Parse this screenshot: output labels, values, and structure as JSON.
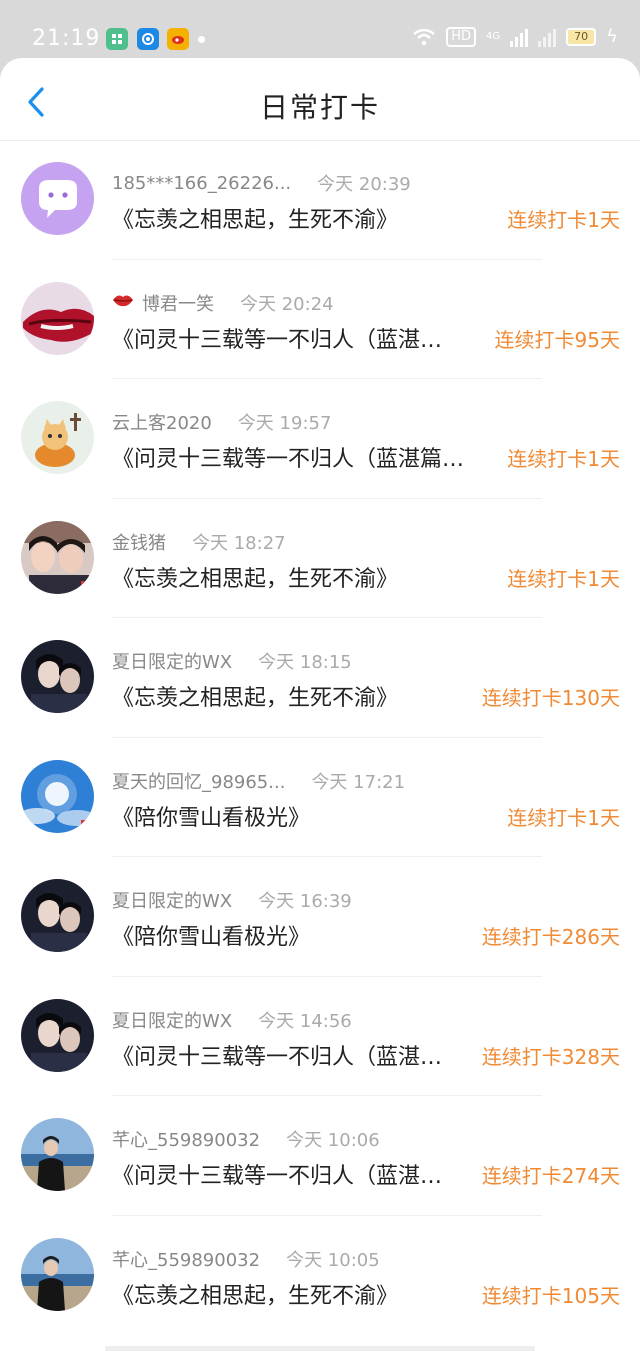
{
  "status_bar": {
    "time": "21:19",
    "hd_label": "HD",
    "network_label": "4G",
    "battery": "70"
  },
  "header": {
    "title": "日常打卡",
    "back_icon": "chevron-left-icon"
  },
  "colors": {
    "accent_back": "#1a8ff0",
    "streak": "#f08a35",
    "name": "#888888",
    "time": "#aaaaaa"
  },
  "items": [
    {
      "name": "185***166_26226...",
      "time": "今天 20:39",
      "title": "《忘羡之相思起，生死不渝》",
      "streak": "连续打卡1天",
      "avatar": "chat-bubble-avatar",
      "badge": ""
    },
    {
      "name": "博君一笑",
      "time": "今天 20:24",
      "title": "《问灵十三载等一不归人（蓝湛…",
      "streak": "连续打卡95天",
      "avatar": "lips-avatar",
      "badge": "lips-icon"
    },
    {
      "name": "云上客2020",
      "time": "今天 19:57",
      "title": "《问灵十三载等一不归人（蓝湛篇…",
      "streak": "连续打卡1天",
      "avatar": "cat-pumpkin-avatar",
      "badge": ""
    },
    {
      "name": "金钱猪",
      "time": "今天 18:27",
      "title": "《忘羡之相思起，生死不渝》",
      "streak": "连续打卡1天",
      "avatar": "two-people-avatar",
      "badge": ""
    },
    {
      "name": "夏日限定的WX",
      "time": "今天 18:15",
      "title": "《忘羡之相思起，生死不渝》",
      "streak": "连续打卡130天",
      "avatar": "dark-portrait-avatar",
      "badge": ""
    },
    {
      "name": "夏天的回忆_98965...",
      "time": "今天 17:21",
      "title": "《陪你雪山看极光》",
      "streak": "连续打卡1天",
      "avatar": "sky-sun-avatar",
      "badge": ""
    },
    {
      "name": "夏日限定的WX",
      "time": "今天 16:39",
      "title": "《陪你雪山看极光》",
      "streak": "连续打卡286天",
      "avatar": "dark-portrait-avatar",
      "badge": ""
    },
    {
      "name": "夏日限定的WX",
      "time": "今天 14:56",
      "title": "《问灵十三载等一不归人（蓝湛…",
      "streak": "连续打卡328天",
      "avatar": "dark-portrait-avatar",
      "badge": ""
    },
    {
      "name": "芊心_559890032",
      "time": "今天 10:06",
      "title": "《问灵十三载等一不归人（蓝湛…",
      "streak": "连续打卡274天",
      "avatar": "seaside-person-avatar",
      "badge": ""
    },
    {
      "name": "芊心_559890032",
      "time": "今天 10:05",
      "title": "《忘羡之相思起，生死不渝》",
      "streak": "连续打卡105天",
      "avatar": "seaside-person-avatar",
      "badge": ""
    }
  ]
}
